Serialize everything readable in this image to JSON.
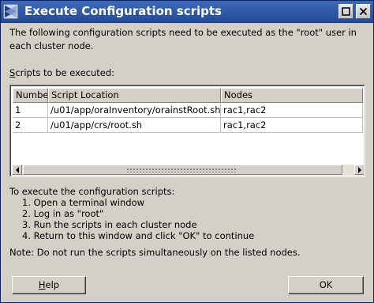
{
  "window": {
    "title": "Execute Configuration scripts",
    "title_bar_color": "#2f5aa8",
    "background_color": "#d4d0c8"
  },
  "titlebar_icons": [
    "maximize-icon",
    "close-icon"
  ],
  "intro_text": "The following configuration scripts need to be executed as the \"root\" user in each cluster node.",
  "scripts_label": {
    "mnemonic": "S",
    "rest": "cripts to be executed:"
  },
  "table": {
    "columns": [
      "Number",
      "Script Location",
      "Nodes"
    ],
    "rows": [
      {
        "number": "1",
        "location": "/u01/app/oraInventory/orainstRoot.sh",
        "nodes": "rac1,rac2"
      },
      {
        "number": "2",
        "location": "/u01/app/crs/root.sh",
        "nodes": "rac1,rac2"
      }
    ]
  },
  "instructions": {
    "heading": "To execute the configuration scripts:",
    "steps": [
      "1. Open a terminal window",
      "2. Log in as \"root\"",
      "3. Run the scripts in each cluster node",
      "4. Return to this window and click \"OK\" to continue"
    ]
  },
  "note": "Note: Do not run the scripts simultaneously on the listed nodes.",
  "buttons": {
    "help_mnemonic": "H",
    "help_rest": "elp",
    "ok_label": "OK"
  }
}
